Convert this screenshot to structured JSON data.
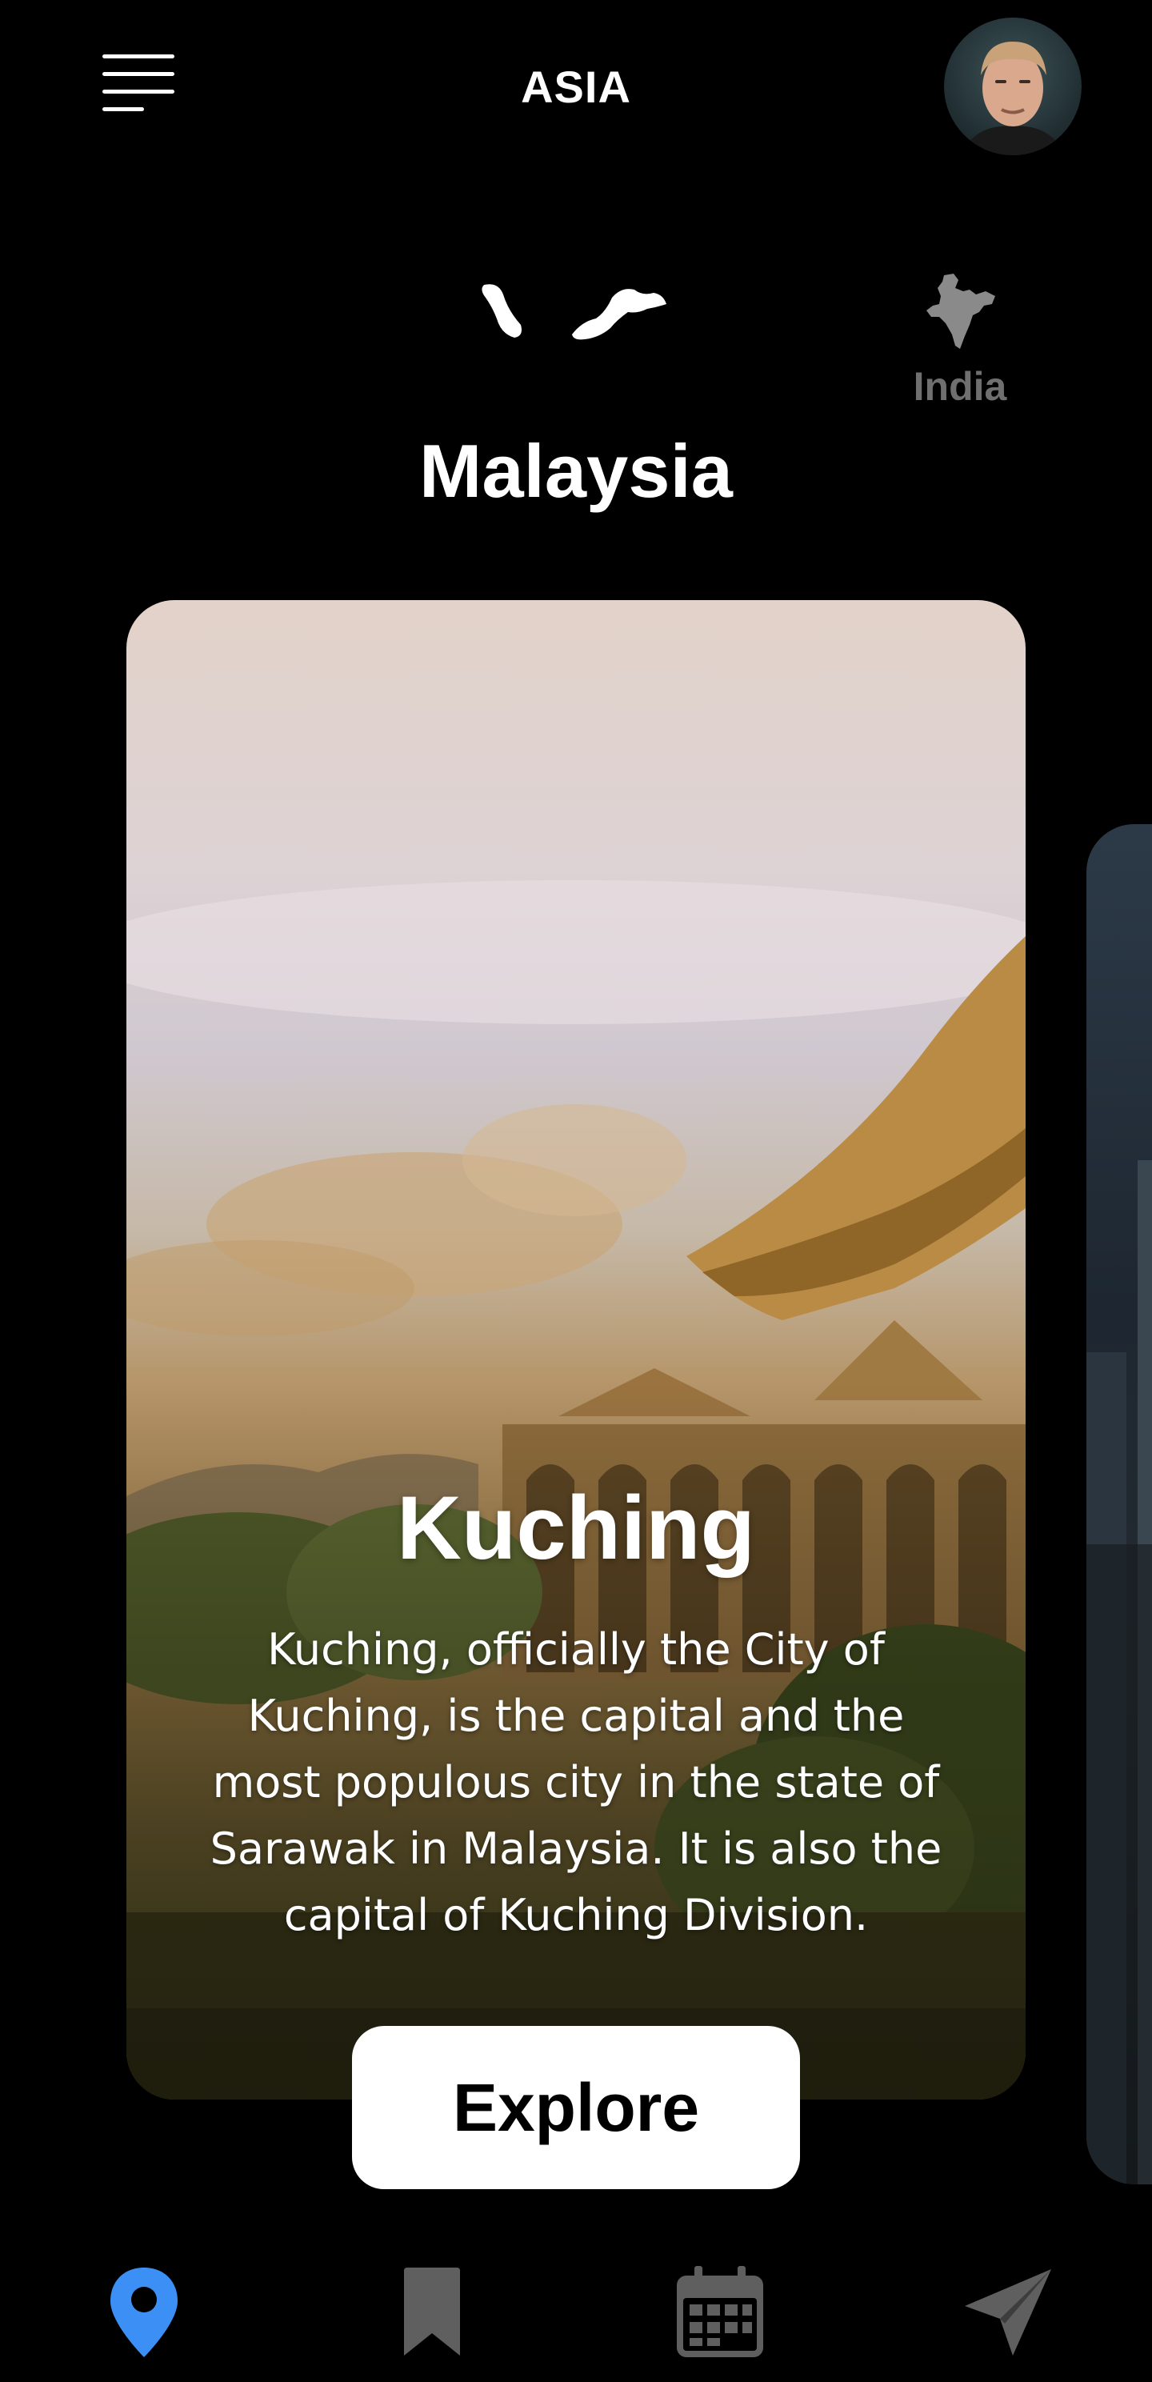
{
  "header": {
    "title": "ASIA",
    "menu_icon": "hamburger-menu-icon",
    "avatar_icon": "user-avatar"
  },
  "countries": {
    "current": {
      "label": "Malaysia",
      "icon": "malaysia-map-icon"
    },
    "next": {
      "label": "India",
      "icon": "india-map-icon"
    }
  },
  "card": {
    "city": "Kuching",
    "description": "Kuching, officially the City of Kuching, is the capital and the most populous city in the state of Sarawak in Malaysia. It is also the capital of Kuching Division.",
    "image": "kuching-legislative-building-photo",
    "button_label": "Explore"
  },
  "next_card": {
    "image": "city-skyline-photo"
  },
  "bottom_nav": {
    "items": [
      {
        "name": "location",
        "icon": "map-pin-icon",
        "active": true
      },
      {
        "name": "bookmarks",
        "icon": "bookmark-icon",
        "active": false
      },
      {
        "name": "calendar",
        "icon": "calendar-icon",
        "active": false
      },
      {
        "name": "send",
        "icon": "paper-plane-icon",
        "active": false
      }
    ]
  },
  "colors": {
    "background": "#000000",
    "text": "#ffffff",
    "muted_text": "#6f6f6f",
    "accent": "#3b8ff5",
    "inactive_icon": "#5f5f5f"
  }
}
